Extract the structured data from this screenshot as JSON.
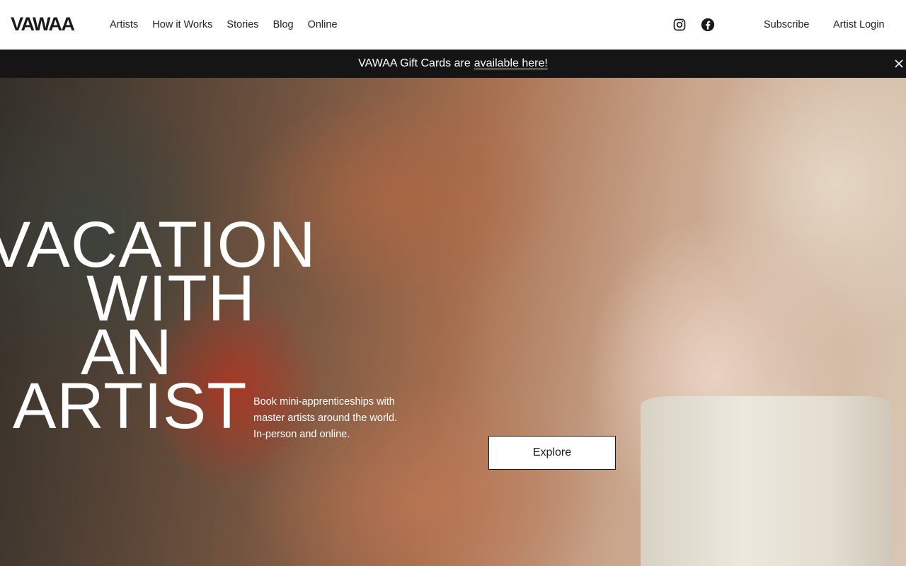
{
  "brand": {
    "logo": "VAWAA"
  },
  "nav": {
    "items": [
      {
        "label": "Artists"
      },
      {
        "label": "How it Works"
      },
      {
        "label": "Stories"
      },
      {
        "label": "Blog"
      },
      {
        "label": "Online"
      }
    ]
  },
  "social": {
    "icons": [
      "instagram-icon",
      "facebook-icon"
    ]
  },
  "header": {
    "subscribe": "Subscribe",
    "artist_login": "Artist Login"
  },
  "banner": {
    "text": "VAWAA Gift Cards are",
    "link": "available here!",
    "close_icon": "close-icon"
  },
  "hero": {
    "headline": [
      "VACATION",
      "WITH",
      "AN",
      "ARTIST"
    ],
    "tagline": "Book mini-apprenticeships with master artists around the world. In-person and online.",
    "cta": "Explore"
  },
  "colors": {
    "banner_bg": "#151515",
    "text_dark": "#1a1a1a",
    "white": "#ffffff"
  }
}
